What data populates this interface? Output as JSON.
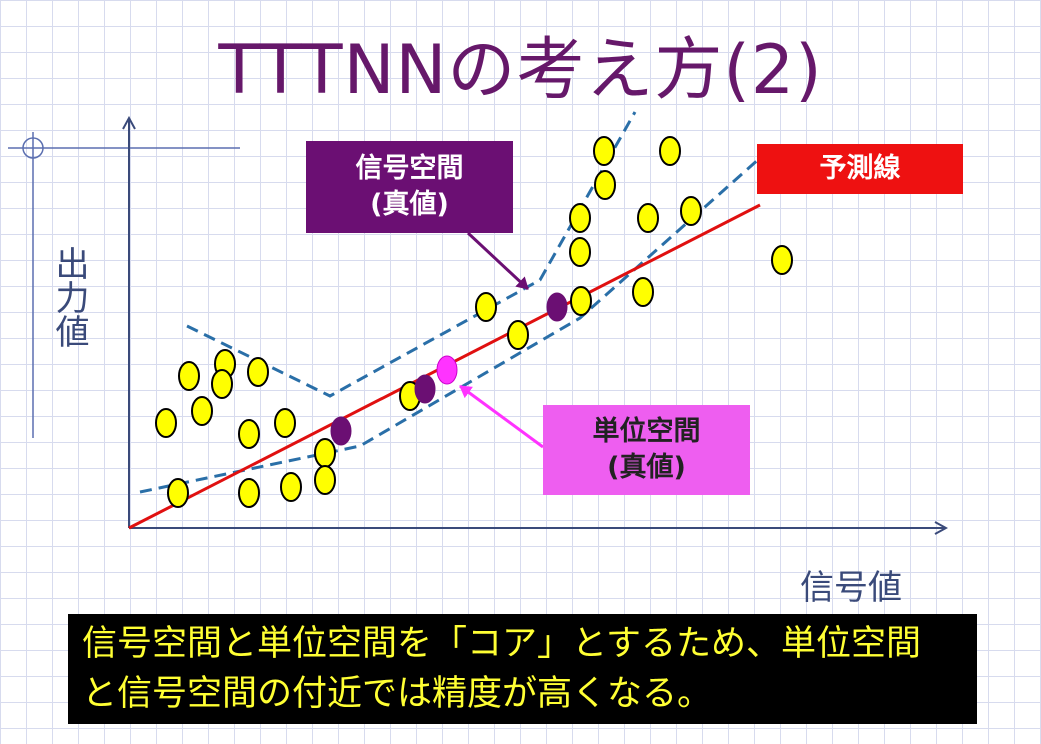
{
  "title": "TTTNNの考え方(2)",
  "y_axis_label": "出力値",
  "x_axis_label": "信号値",
  "labels": {
    "signal_space": "信号空間\n(真値)",
    "unit_space": "単位空間\n(真値)",
    "prediction_line": "予測線"
  },
  "caption_lines": [
    "信号空間と単位空間を「コア」とするため、単位空間",
    "と信号空間の付近では精度が高くなる。"
  ],
  "colors": {
    "title": "#66186a",
    "data_point": "#ffff00",
    "signal_point": "#6b0f73",
    "unit_point": "#ff33ff",
    "prediction_line": "#e01010",
    "dashed_band": "#2a6fa8",
    "axis": "#3a4a7a",
    "caption_bg": "#000000",
    "caption_text": "#ffff33"
  }
}
